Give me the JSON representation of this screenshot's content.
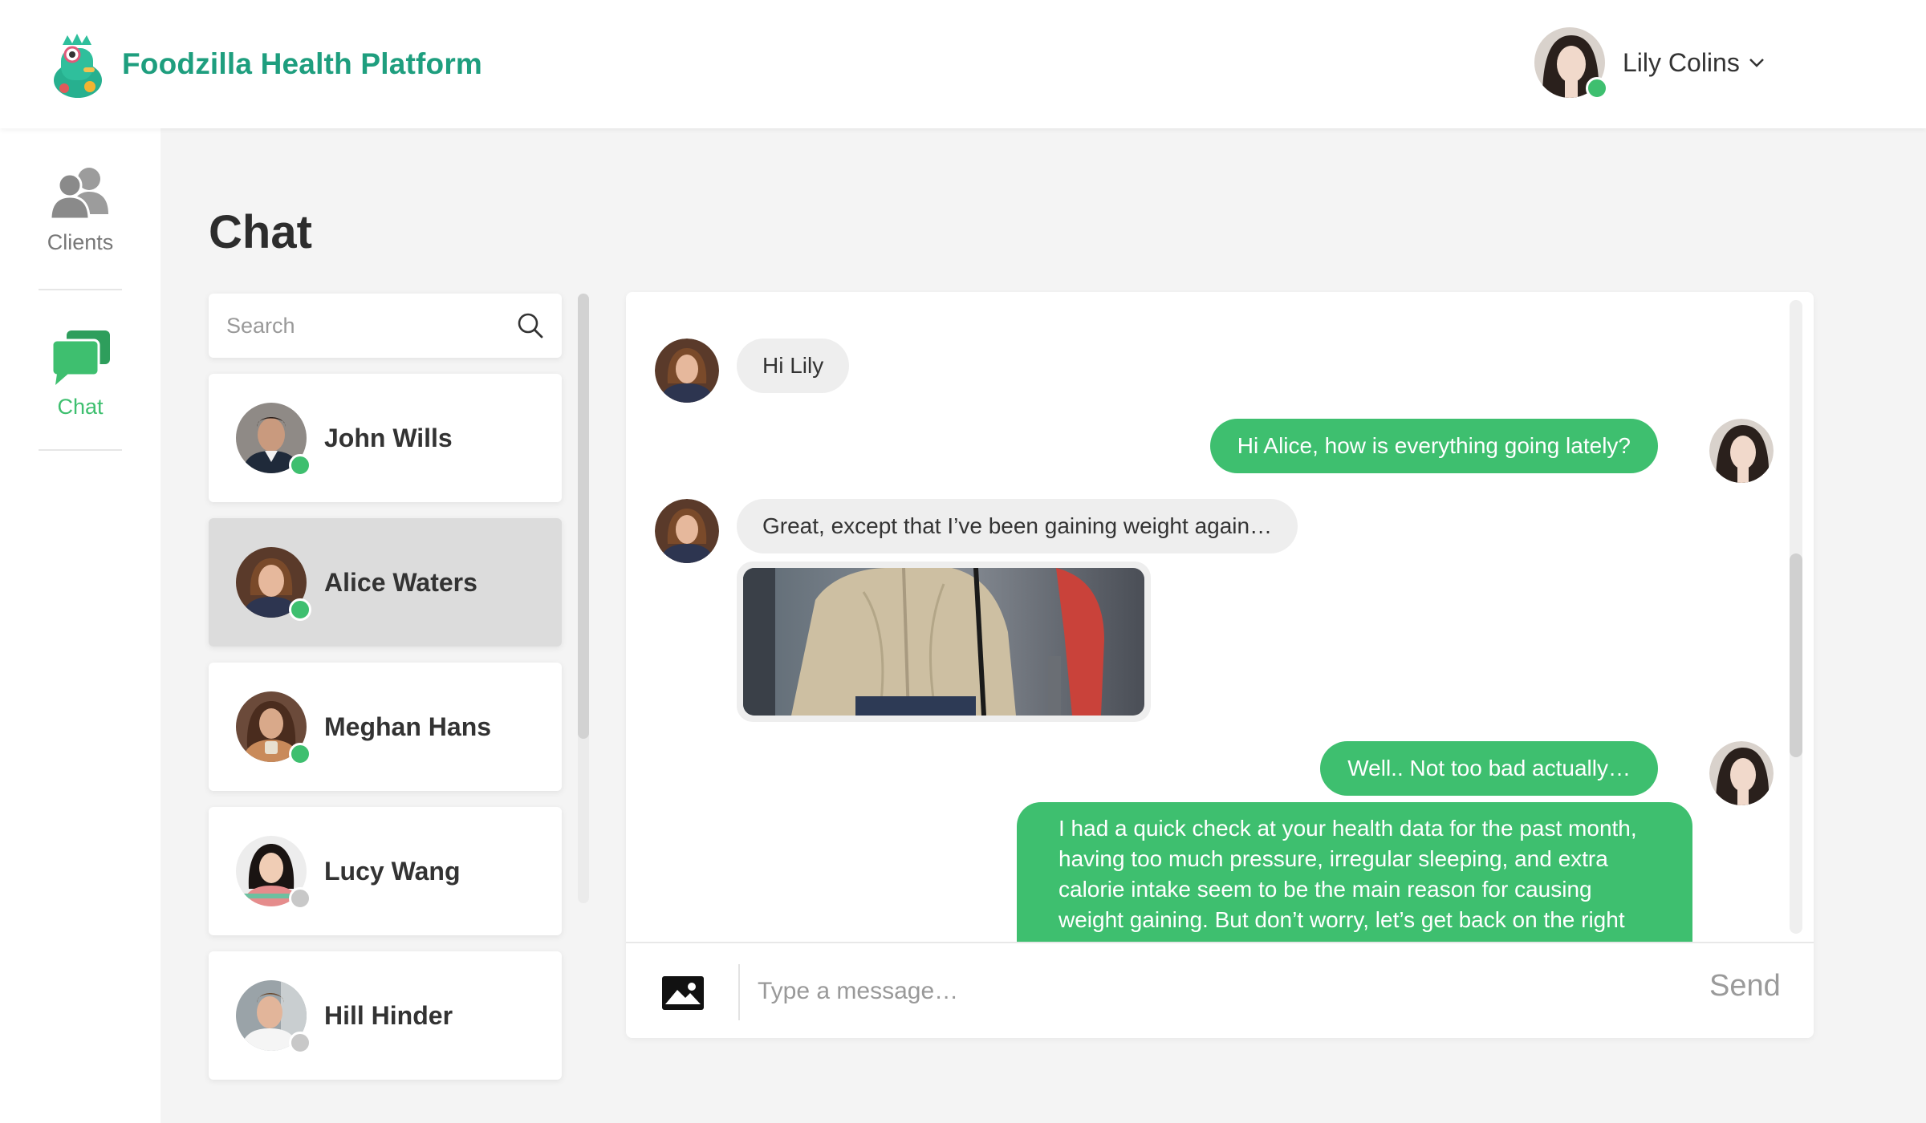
{
  "app": {
    "title": "Foodzilla Health Platform",
    "brand_color": "#1e9e7e",
    "accent_color": "#3ebf6f",
    "logo_icon": "foodzilla-logo-icon"
  },
  "header": {
    "user_name": "Lily Colins",
    "user_status_color": "#3ebf6f",
    "menu_icon": "chevron-down-icon"
  },
  "sidebar": {
    "items": [
      {
        "label": "Clients",
        "icon": "clients-icon",
        "active": false
      },
      {
        "label": "Chat",
        "icon": "chat-icon",
        "active": true
      }
    ]
  },
  "page": {
    "title": "Chat"
  },
  "search": {
    "placeholder": "Search",
    "value": "",
    "icon": "search-icon"
  },
  "contacts": [
    {
      "name": "John Wills",
      "online": true,
      "selected": false
    },
    {
      "name": "Alice Waters",
      "online": true,
      "selected": true
    },
    {
      "name": "Meghan Hans",
      "online": true,
      "selected": false
    },
    {
      "name": "Lucy Wang",
      "online": false,
      "selected": false
    },
    {
      "name": "Hill Hinder",
      "online": false,
      "selected": false
    }
  ],
  "status_colors": {
    "online": "#3ebf6f",
    "offline": "#c8c8c8"
  },
  "messages": [
    {
      "from": "Alice Waters",
      "direction": "in",
      "text": "Hi Lily"
    },
    {
      "from": "Lily Colins",
      "direction": "out",
      "text": "Hi Alice, how is everything going lately?"
    },
    {
      "from": "Alice Waters",
      "direction": "in",
      "text": "Great, except that I’ve been gaining weight again…"
    },
    {
      "from": "Alice Waters",
      "direction": "in",
      "type": "image"
    },
    {
      "from": "Lily Colins",
      "direction": "out",
      "text": "Well.. Not too bad actually…"
    },
    {
      "from": "Lily Colins",
      "direction": "out",
      "text": "I had a quick check at your health data for the past month, having too much pressure, irregular sleeping, and extra calorie intake seem to be the main reason for causing weight gaining. But don’t worry, let’s get back on the right"
    }
  ],
  "composer": {
    "placeholder": "Type a message…",
    "value": "",
    "send_label": "Send",
    "attach_icon": "image-icon"
  }
}
